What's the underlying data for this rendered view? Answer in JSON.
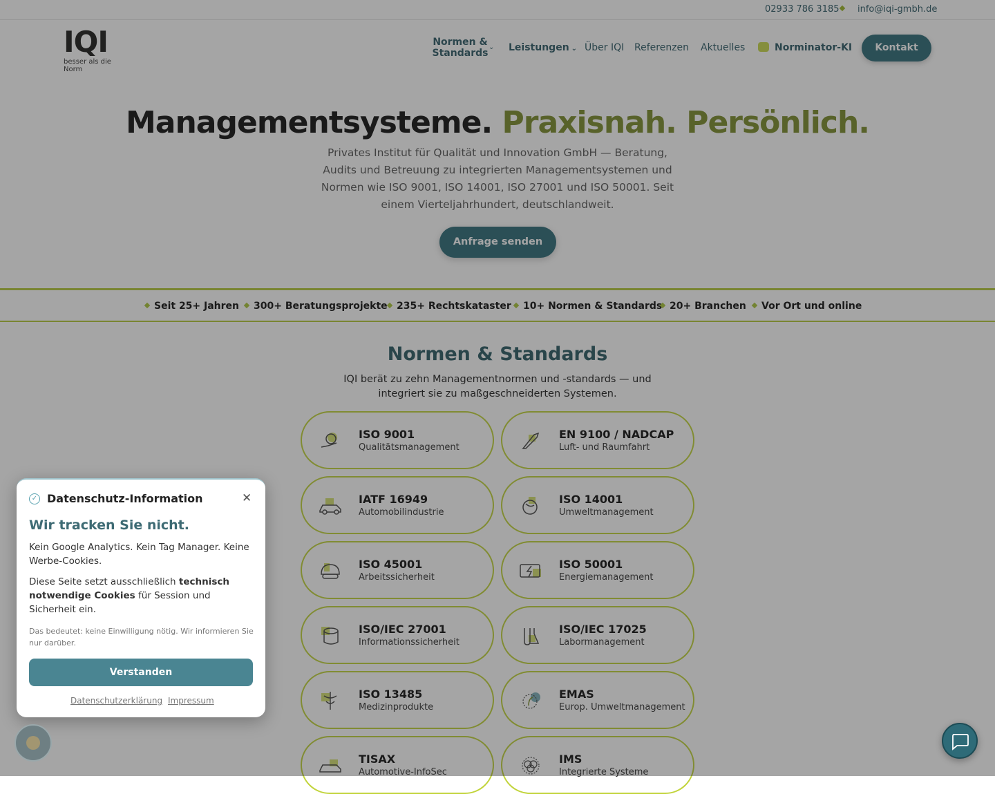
{
  "topbar": {
    "phone": "02933 786 3185",
    "email": "info@iqi-gmbh.de"
  },
  "logo": {
    "word_a": "IQ",
    "word_b": "I",
    "tagline": "besser als die Norm"
  },
  "nav": {
    "normen_line1": "Normen &",
    "normen_line2": "Standards",
    "leistungen": "Leistungen",
    "ueber": "Über IQI",
    "referenzen": "Referenzen",
    "aktuelles": "Aktuelles",
    "norminator": "Norminator-KI",
    "kontakt": "Kontakt"
  },
  "hero": {
    "title_a": "Managementsysteme.",
    "title_b": "Praxisnah. Persönlich.",
    "subtitle": "Privates Institut für Qualität und Innovation GmbH — Beratung, Audits und Betreuung zu integrierten Managementsystemen und Normen wie ISO 9001, ISO 14001, ISO 27001 und ISO 50001. Seit einem Vierteljahrhundert, deutschlandweit.",
    "cta": "Anfrage senden"
  },
  "facts": [
    "Seit 25+ Jahren",
    "300+ Beratungsprojekte",
    "235+ Rechtskataster",
    "10+ Normen & Standards",
    "20+ Branchen",
    "Vor Ort und online"
  ],
  "standards_section": {
    "title": "Normen & Standards",
    "subtitle": "IQI berät zu zehn Managementnormen und -standards — und integriert sie zu maßgeschneiderten Systemen."
  },
  "standards": [
    {
      "title": "ISO 9001",
      "sub": "Qualitätsmanagement"
    },
    {
      "title": "EN 9100 / NADCAP",
      "sub": "Luft- und Raumfahrt"
    },
    {
      "title": "IATF 16949",
      "sub": "Automobilindustrie"
    },
    {
      "title": "ISO 14001",
      "sub": "Umweltmanagement"
    },
    {
      "title": "ISO 45001",
      "sub": "Arbeitssicherheit"
    },
    {
      "title": "ISO 50001",
      "sub": "Energiemanagement"
    },
    {
      "title": "ISO/IEC 27001",
      "sub": "Informationssicherheit"
    },
    {
      "title": "ISO/IEC 17025",
      "sub": "Labormanagement"
    },
    {
      "title": "ISO 13485",
      "sub": "Medizinprodukte"
    },
    {
      "title": "EMAS",
      "sub": "Europ. Umweltmanagement"
    },
    {
      "title": "TISAX",
      "sub": "Automotive-InfoSec"
    },
    {
      "title": "IMS",
      "sub": "Integrierte Systeme"
    }
  ],
  "cookie": {
    "header": "Datenschutz-Information",
    "headline": "Wir tracken Sie nicht.",
    "p1": "Kein Google Analytics. Kein Tag Manager. Keine Werbe-Cookies.",
    "p2_a": "Diese Seite setzt ausschließlich ",
    "p2_b": "technisch notwendige Cookies",
    "p2_c": " für Session und Sicherheit ein.",
    "p3": "Das bedeutet: keine Einwilligung nötig. Wir informieren Sie nur darüber.",
    "button": "Verstanden",
    "link_privacy": "Datenschutzerklärung",
    "link_imprint": "Impressum"
  },
  "colors": {
    "accent": "#2e6b78",
    "lime": "#a9c43a",
    "olive": "#7b8c2b"
  }
}
